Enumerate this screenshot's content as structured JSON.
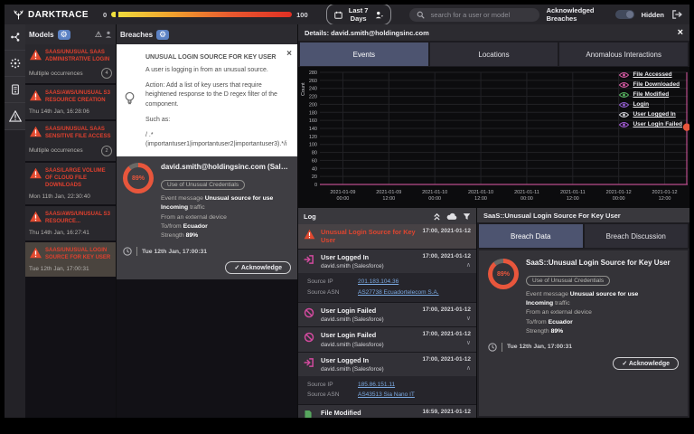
{
  "topbar": {
    "brand": "DARKTRACE",
    "slider_min": "0",
    "slider_max": "100",
    "time_range": "Last 7 Days",
    "search_placeholder": "search for a user or model",
    "ack_label": "Acknowledged Breaches",
    "hidden_label": "Hidden"
  },
  "icons": {
    "brand": "darktrace-antler",
    "calendar": "calendar",
    "person": "person-silhouette",
    "search": "magnifier",
    "logout": "exit-arrow",
    "gear": "⚙",
    "warning": "⚠",
    "cloud": "☁",
    "filter": "funnel",
    "collapse": "double-chevron-up",
    "legend_eye": "eye",
    "clock": "clock-face",
    "check": "✓",
    "close": "×",
    "lightbulb": "bulb",
    "login": "arrow-into-bracket",
    "ban": "no-entry-circle",
    "file": "document"
  },
  "models_panel": {
    "title": "Models",
    "items": [
      {
        "title": "SAAS/UNUSUAL SAAS ADMINISTRATIVE LOGIN",
        "subtitle": "Multiple occurrences",
        "badge": "4",
        "selected": false
      },
      {
        "title": "SAAS/AWS/UNUSUAL S3 RESOURCE CREATION",
        "subtitle": "Thu 14th Jan, 16:28:06",
        "badge": "",
        "selected": false
      },
      {
        "title": "SAAS/UNUSUAL SAAS SENSITIVE FILE ACCESS",
        "subtitle": "Multiple occurrences",
        "badge": "2",
        "selected": false
      },
      {
        "title": "SAAS/LARGE VOLUME OF CLOUD FILE DOWNLOADS",
        "subtitle": "Mon 11th Jan, 22:30:40",
        "badge": "",
        "selected": false
      },
      {
        "title": "SAAS/AWS/UNUSUAL S3 RESOURCE...",
        "subtitle": "Thu 14th Jan, 16:27:41",
        "badge": "",
        "selected": false
      },
      {
        "title": "SAAS/UNUSUAL LOGIN SOURCE FOR KEY USER",
        "subtitle": "Tue 12th Jan, 17:00:31",
        "badge": "",
        "selected": true
      }
    ]
  },
  "breaches_panel": {
    "title": "Breaches",
    "tip": {
      "title": "UNUSUAL LOGIN SOURCE FOR KEY USER",
      "description": "A user is logging in from an unusual source.",
      "action": "Action: Add a list of key users that require heightened response to the D regex filter of the component.",
      "such_as": "Such as:",
      "regex": "/ .*\n(importantuser1|importantuser2|importantuser3).*/i"
    },
    "breach": {
      "score": "89%",
      "title": "david.smith@holdingsinc.com (Salesforce)",
      "tag": "Use of Unusual Credentials",
      "lines": [
        {
          "pre": "Event message ",
          "bold": "Unusual source for use",
          "post": ""
        },
        {
          "pre": "",
          "bold": "Incoming",
          "post": " traffic"
        },
        {
          "pre": "From an external device",
          "bold": "",
          "post": ""
        },
        {
          "pre": "To/from ",
          "bold": "Ecuador",
          "post": ""
        },
        {
          "pre": "Strength ",
          "bold": "89%",
          "post": ""
        }
      ],
      "timestamp": "Tue 12th Jan, 17:00:31",
      "ack_label": "Acknowledge"
    }
  },
  "details_panel": {
    "title": "Details: david.smith@holdingsinc.com",
    "tabs": [
      {
        "label": "Events",
        "active": true
      },
      {
        "label": "Locations",
        "active": false
      },
      {
        "label": "Anomalous Interactions",
        "active": false
      }
    ]
  },
  "chart_data": {
    "type": "scatter",
    "title": "",
    "xlabel": "",
    "ylabel": "Count",
    "ylim": [
      0,
      280
    ],
    "ytick_step": 20,
    "x_ticks": [
      "2021-01-09 00:00",
      "2021-01-09 12:00",
      "2021-01-10 00:00",
      "2021-01-10 12:00",
      "2021-01-11 00:00",
      "2021-01-11 12:00",
      "2021-01-12 00:00",
      "2021-01-12 12:00"
    ],
    "grid": true,
    "baseline_series": {
      "y": 0,
      "color": "#b84d8a"
    },
    "event_marker": {
      "x": "2021-01-12 17:00",
      "y": 143,
      "line_color": "#b84d8a",
      "dot_color": "#e8563c"
    },
    "legend_position": "top-right",
    "legend": [
      {
        "label": "File Accessed",
        "color": "#d0589f"
      },
      {
        "label": "File Downloaded",
        "color": "#d0589f"
      },
      {
        "label": "File Modified",
        "color": "#55b05e"
      },
      {
        "label": "Login",
        "color": "#8e5bc9"
      },
      {
        "label": "User Logged In",
        "color": "#c9c9cf"
      },
      {
        "label": "User Login Failed",
        "color": "#a05ad0"
      }
    ]
  },
  "log_panel": {
    "title": "Log",
    "entries": [
      {
        "type": "alert",
        "title": "Unusual Login Source for Key User",
        "subtitle": "",
        "time": "17:00, 2021-01-12",
        "highlighted": true,
        "expanded": false,
        "details": []
      },
      {
        "type": "login",
        "title": "User Logged In",
        "subtitle": "david.smith (Salesforce)",
        "time": "17:00, 2021-01-12",
        "highlighted": false,
        "expanded": true,
        "details": [
          {
            "label": "Source IP",
            "value": "201.183.104.36"
          },
          {
            "label": "Source ASN",
            "value": "AS27738 Ecuadortelecom S.A."
          }
        ]
      },
      {
        "type": "ban",
        "title": "User Login Failed",
        "subtitle": "david.smith (Salesforce)",
        "time": "17:00, 2021-01-12",
        "highlighted": false,
        "expanded": false,
        "details": []
      },
      {
        "type": "ban",
        "title": "User Login Failed",
        "subtitle": "david.smith (Salesforce)",
        "time": "17:00, 2021-01-12",
        "highlighted": false,
        "expanded": false,
        "details": []
      },
      {
        "type": "login",
        "title": "User Logged In",
        "subtitle": "david.smith (Salesforce)",
        "time": "17:00, 2021-01-12",
        "highlighted": false,
        "expanded": true,
        "details": [
          {
            "label": "Source IP",
            "value": "185.86.151.11"
          },
          {
            "label": "Source ASN",
            "value": "AS43513 Sia Nano IT"
          }
        ]
      },
      {
        "type": "file",
        "title": "File Modified",
        "subtitle": "",
        "time": "16:59, 2021-01-12",
        "highlighted": false,
        "expanded": false,
        "details": []
      }
    ]
  },
  "breach_detail_panel": {
    "title": "SaaS::Unusual Login Source For Key User",
    "tabs": [
      {
        "label": "Breach Data",
        "active": true
      },
      {
        "label": "Breach Discussion",
        "active": false
      }
    ],
    "breach": {
      "score": "89%",
      "title": "SaaS::Unusual Login Source for Key User",
      "tag": "Use of Unusual Credentials",
      "lines": [
        {
          "pre": "Event message ",
          "bold": "Unusual source for use",
          "post": ""
        },
        {
          "pre": "",
          "bold": "Incoming",
          "post": " traffic"
        },
        {
          "pre": "From an external device",
          "bold": "",
          "post": ""
        },
        {
          "pre": "To/from ",
          "bold": "Ecuador",
          "post": ""
        },
        {
          "pre": "Strength ",
          "bold": "89%",
          "post": ""
        }
      ],
      "timestamp": "Tue 12th Jan, 17:00:31",
      "ack_label": "Acknowledge"
    }
  }
}
